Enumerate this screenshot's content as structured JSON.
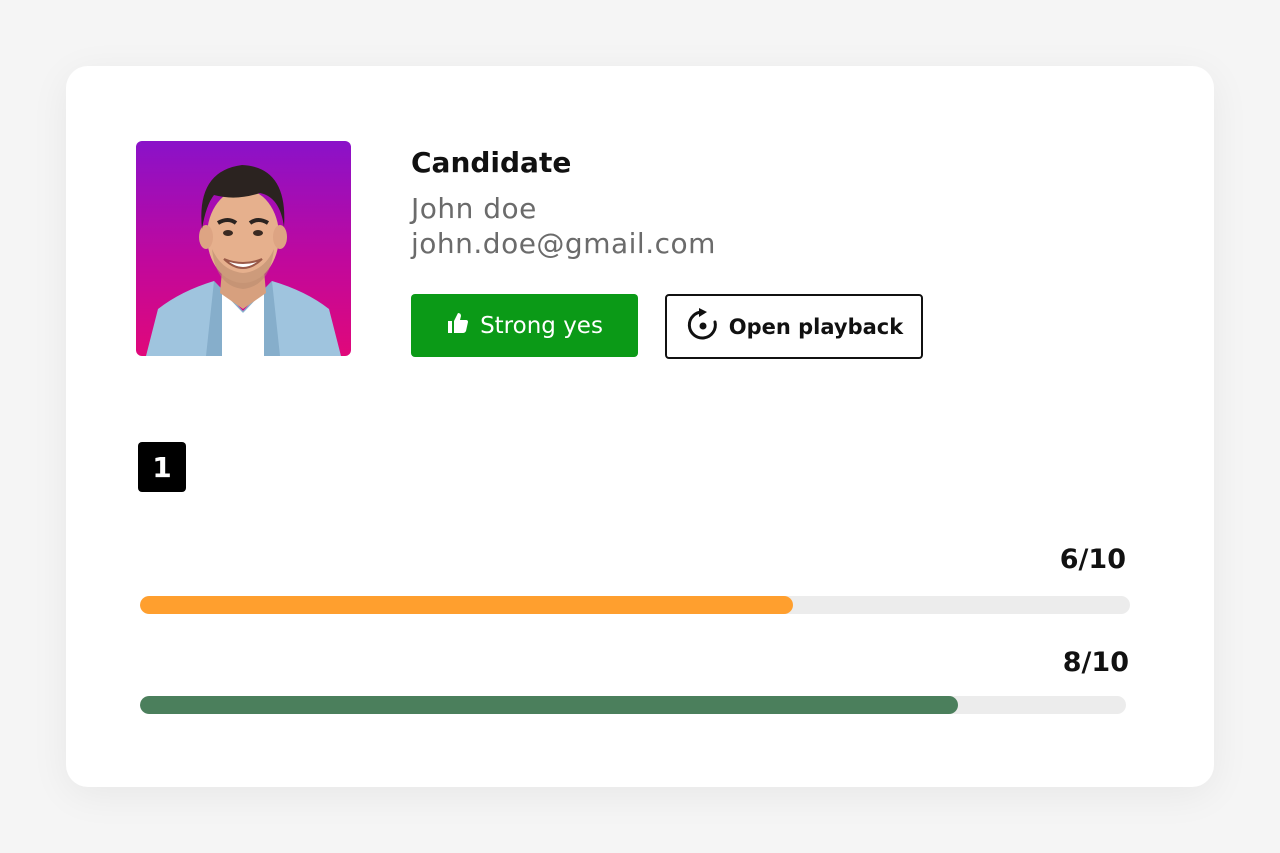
{
  "candidate": {
    "label": "Candidate",
    "name": "John doe",
    "email": "john.doe@gmail.com"
  },
  "actions": {
    "strong_yes_label": "Strong yes",
    "open_playback_label": "Open playback"
  },
  "section": {
    "index": "1"
  },
  "scores": [
    {
      "text": "6/10",
      "value": 6,
      "max": 10,
      "color": "#ff9f2e"
    },
    {
      "text": "8/10",
      "value": 8,
      "max": 10,
      "color": "#4b7f5c"
    }
  ],
  "icons": {
    "strong_yes": "thumbs-up-icon",
    "open_playback": "replay-icon"
  }
}
